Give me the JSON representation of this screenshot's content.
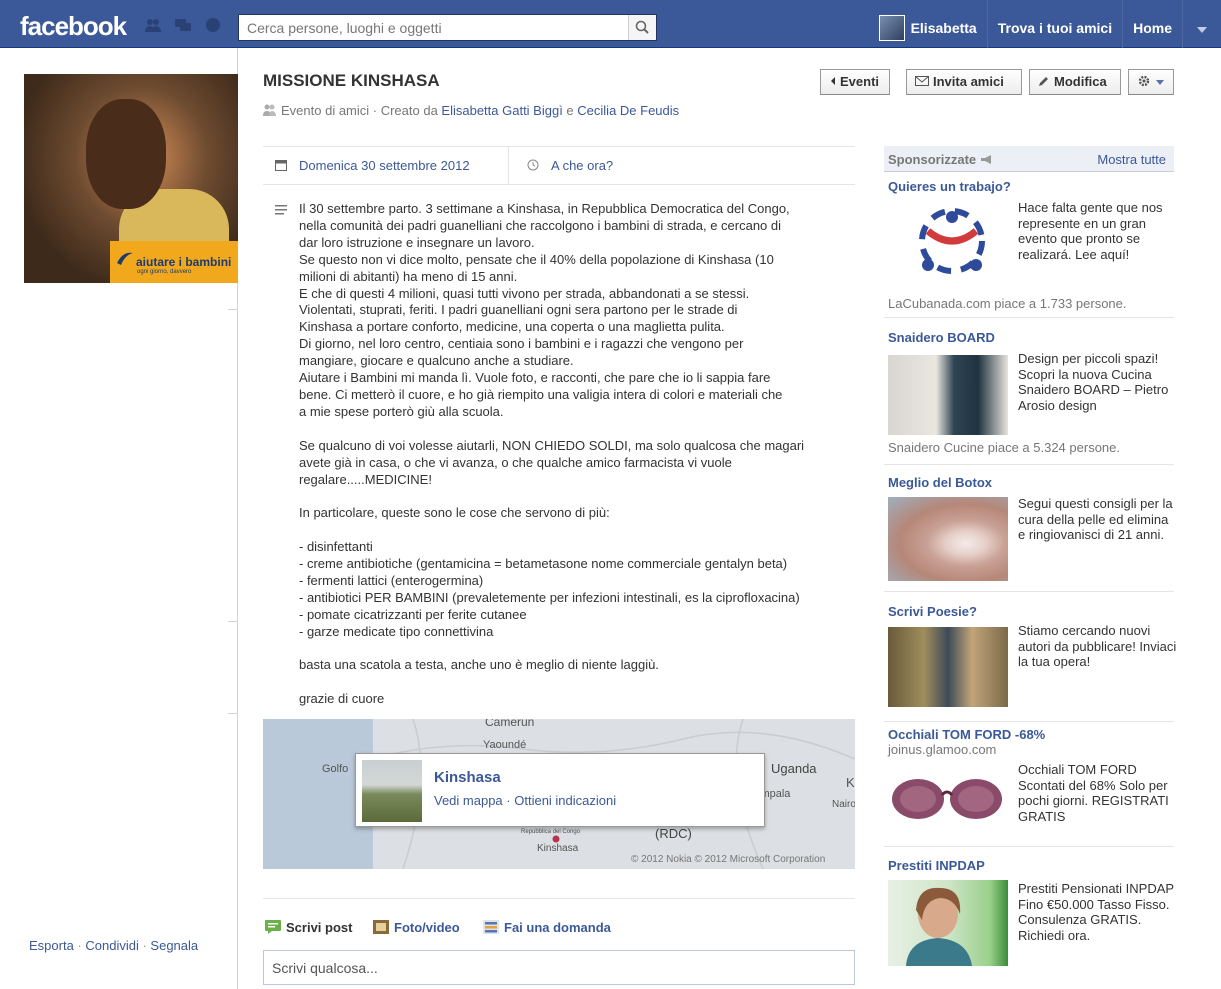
{
  "topbar": {
    "logo": "facebook",
    "search_placeholder": "Cerca persone, luoghi e oggetti",
    "user_name": "Elisabetta",
    "find_friends": "Trova i tuoi amici",
    "home": "Home"
  },
  "left": {
    "badge_text": "aiutare i bambini",
    "badge_sub": "ogni giorno, davvero",
    "links": {
      "export": "Esporta",
      "share": "Condividi",
      "report": "Segnala"
    },
    "sep": " · "
  },
  "event": {
    "title": "MISSIONE KINSHASA",
    "subtitle_prefix": "Evento di amici · Creato da ",
    "creator1": "Elisabetta Gatti Biggì",
    "and": " e ",
    "creator2": "Cecilia De Feudis",
    "buttons": {
      "events": "Eventi",
      "invite": "Invita amici",
      "edit": "Modifica"
    },
    "date": "Domenica 30 settembre 2012",
    "time": "A che ora?",
    "description": "Il 30 settembre parto. 3 settimane a Kinshasa, in Repubblica Democratica del Congo,\nnella comunità dei padri guanelliani che raccolgono i bambini di strada, e cercano di\ndar loro istruzione e insegnare un lavoro.\nSe questo non vi dice molto, pensate che il 40% della popolazione di Kinshasa (10\nmilioni di abitanti) ha meno di 15 anni.\nE che di questi 4 milioni, quasi tutti vivono per strada, abbandonati a se stessi.\nViolentati, stuprati, feriti. I padri guanelliani ogni sera partono per le strade di\nKinshasa a portare conforto, medicine, una coperta o una maglietta pulita.\nDi giorno, nel loro centro, centiaia sono i bambini e i ragazzi che vengono per\nmangiare, giocare e qualcuno anche a studiare.\nAiutare i Bambini mi manda lì. Vuole foto, e racconti, che pare che io li sappia fare\nbene. Ci metterò il cuore, e ho già riempito una valigia intera di colori e materiali che\na mie spese porterò giù alla scuola.\n\nSe qualcuno di voi volesse aiutarli, NON CHIEDO SOLDI, ma solo qualcosa che magari\navete già in casa, o che vi avanza, o che qualche amico farmacista vi vuole\nregalare.....MEDICINE!\n\nIn particolare, queste sono le cose che servono di più:\n\n- disinfettanti\n- creme antibiotiche (gentamicina = betametasone nome commerciale gentalyn beta)\n- fermenti lattici (enterogermina)\n- antibiotici PER BAMBINI (prevaletemente per infezioni intestinali, es la ciprofloxacina)\n- pomate cicatrizzanti per ferite cutanee\n- garze medicate tipo connettivina\n\nbasta una scatola a testa, anche uno è meglio di niente laggiù.\n\ngrazie di cuore"
  },
  "map": {
    "labels": [
      "Camerun",
      "Yaoundé",
      "Golfo",
      "Uganda",
      "Kampala",
      "Nairo",
      "K",
      "(RDC)",
      "Repubblica del Congo",
      "Kinshasa"
    ],
    "copyright": "© 2012 Nokia © 2012 Microsoft Corporation",
    "popup_title": "Kinshasa",
    "popup_map": "Vedi mappa",
    "popup_sep": " · ",
    "popup_directions": "Ottieni indicazioni"
  },
  "composer": {
    "tab_post": "Scrivi post",
    "tab_photo": "Foto/video",
    "tab_question": "Fai una domanda",
    "placeholder": "Scrivi qualcosa..."
  },
  "sidebar": {
    "title": "Sponsorizzate",
    "see_all": "Mostra tutte",
    "ads": [
      {
        "title": "Quieres un trabajo?",
        "text": "Hace falta gente que nos represente en un gran evento que pronto se realizará. Lee aquí!",
        "like": "LaCubanada.com piace a 1.733 persone."
      },
      {
        "title": "Snaidero BOARD",
        "text": "Design per piccoli spazi! Scopri la nuova Cucina Snaidero BOARD – Pietro Arosio design",
        "like": "Snaidero Cucine piace a 5.324 persone."
      },
      {
        "title": "Meglio del Botox",
        "text": "Segui questi consigli per la cura della pelle ed elimina e ringiovanisci di 21 anni."
      },
      {
        "title": "Scrivi Poesie?",
        "text": "Stiamo cercando nuovi autori da pubblicare! Inviaci la tua opera!"
      },
      {
        "title": "Occhiali TOM FORD -68%",
        "sub": "joinus.glamoo.com",
        "text": "Occhiali TOM FORD Scontati del 68% Solo per pochi giorni. REGISTRATI GRATIS"
      },
      {
        "title": "Prestiti INPDAP",
        "text": "Prestiti Pensionati INPDAP Fino €50.000 Tasso Fisso. Consulenza GRATIS. Richiedi ora."
      }
    ]
  }
}
